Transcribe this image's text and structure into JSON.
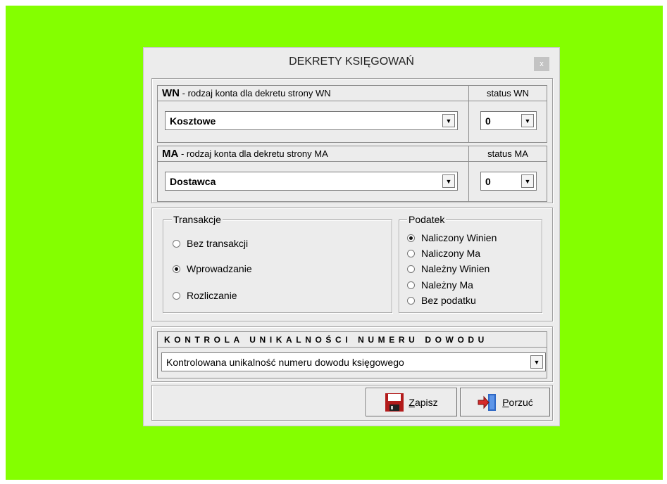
{
  "dialog": {
    "title": "DEKRETY KSIĘGOWAŃ",
    "close_label": "x"
  },
  "wn": {
    "prefix": "WN",
    "label": "- rodzaj konta dla dekretu strony  WN",
    "status_label": "status WN",
    "account_value": "Kosztowe",
    "status_value": "0"
  },
  "ma": {
    "prefix": "MA",
    "label": "- rodzaj konta dla dekretu strony  MA",
    "status_label": "status MA",
    "account_value": "Dostawca",
    "status_value": "0"
  },
  "transakcje": {
    "title": "Transakcje",
    "options": [
      {
        "label": "Bez transakcji",
        "checked": false
      },
      {
        "label": "Wprowadzanie",
        "checked": true
      },
      {
        "label": "Rozliczanie",
        "checked": false
      }
    ]
  },
  "podatek": {
    "title": "Podatek",
    "options": [
      {
        "label": "Naliczony Winien",
        "checked": true
      },
      {
        "label": "Naliczony Ma",
        "checked": false
      },
      {
        "label": "Należny Winien",
        "checked": false
      },
      {
        "label": "Należny Ma",
        "checked": false
      },
      {
        "label": "Bez podatku",
        "checked": false
      }
    ]
  },
  "kontrola": {
    "title": "KONTROLA UNIKALNOŚCI NUMERU DOWODU",
    "value": "Kontrolowana unikalność numeru dowodu księgowego"
  },
  "buttons": {
    "save_hotkey": "Z",
    "save_rest": "apisz",
    "cancel_hotkey": "P",
    "cancel_rest": "orzuć"
  },
  "icons": {
    "save": "floppy-disk-icon",
    "cancel": "exit-door-icon"
  }
}
